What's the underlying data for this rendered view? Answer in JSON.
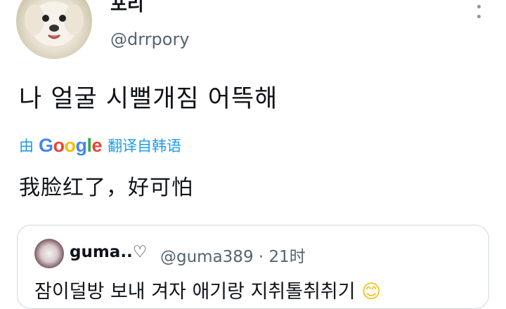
{
  "author": {
    "display_name": "포리",
    "handle": "@drrpory"
  },
  "tweet": {
    "text": "나 얼굴 시뻘개짐 어뜩해"
  },
  "translation": {
    "prefix": "由",
    "provider_letters": [
      "G",
      "o",
      "o",
      "g",
      "l",
      "e"
    ],
    "suffix": "翻译自韩语",
    "text": "我脸红了，好可怕"
  },
  "quoted_tweet": {
    "display_name": "guma..♡",
    "handle": "@guma389",
    "separator": "·",
    "time": "21时",
    "text": "잠이덜방 보내 겨자 애기랑 지취톨취취기",
    "emoji": "😊"
  },
  "colors": {
    "link_blue": "#1d9bf0",
    "secondary_text": "#536471",
    "border": "#cfd9de"
  },
  "icons": {
    "more": "more-vertical-icon"
  }
}
